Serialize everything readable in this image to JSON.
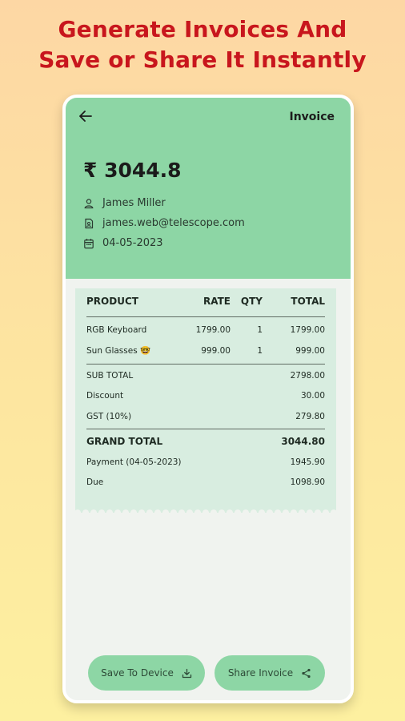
{
  "banner": {
    "line1": "Generate Invoices And",
    "line2": "Save or Share It Instantly"
  },
  "appbar": {
    "title": "Invoice",
    "back_icon": "arrow-left-icon"
  },
  "summary": {
    "amount": "₹ 3044.8",
    "customer_name": "James Miller",
    "email": "james.web@telescope.com",
    "date": "04-05-2023"
  },
  "table": {
    "headers": [
      "PRODUCT",
      "RATE",
      "QTY",
      "TOTAL"
    ],
    "items": [
      {
        "product": "RGB Keyboard",
        "rate": "1799.00",
        "qty": "1",
        "total": "1799.00"
      },
      {
        "product": "Sun Glasses 🤓",
        "rate": "999.00",
        "qty": "1",
        "total": "999.00"
      }
    ],
    "subtotals": [
      {
        "label": "SUB TOTAL",
        "value": "2798.00"
      },
      {
        "label": "Discount",
        "value": "30.00"
      },
      {
        "label": "GST (10%)",
        "value": "279.80"
      }
    ],
    "grand_total": {
      "label": "GRAND TOTAL",
      "value": "3044.80"
    },
    "payments": [
      {
        "label": "Payment (04-05-2023)",
        "value": "1945.90"
      },
      {
        "label": "Due",
        "value": "1098.90"
      }
    ]
  },
  "actions": {
    "save_label": "Save To Device",
    "share_label": "Share Invoice"
  },
  "colors": {
    "accent": "#8dd6a5",
    "receipt": "#d8ede0",
    "headline": "#c8161d"
  }
}
